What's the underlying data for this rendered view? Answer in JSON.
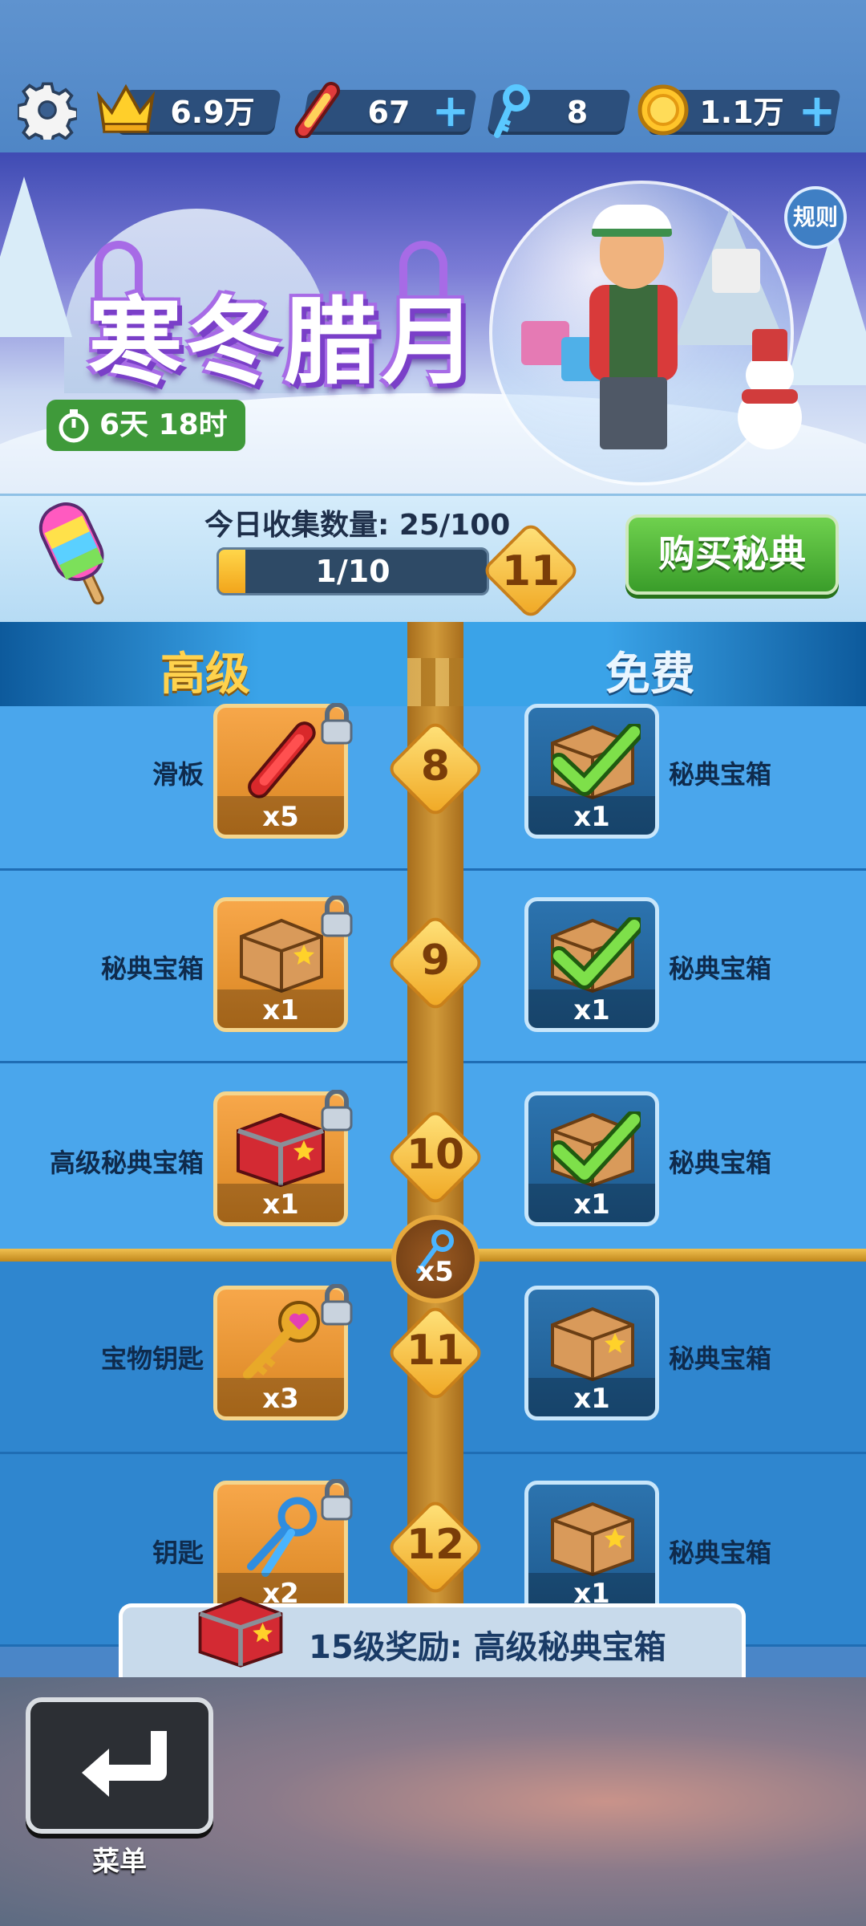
{
  "resources": {
    "crowns": "6.9万",
    "boards": "67",
    "keys": "8",
    "coins": "1.1万"
  },
  "event": {
    "title": "寒冬腊月",
    "timer": "6天 18时",
    "rules_label": "规则"
  },
  "collection": {
    "label": "今日收集数量: 25/100",
    "progress_text": "1/10",
    "progress_fraction": 0.1,
    "next_level": "11",
    "buy_label": "购买秘典"
  },
  "columns": {
    "premium": "高级",
    "free": "免费"
  },
  "rows": [
    {
      "level": "8",
      "premium_label": "滑板",
      "premium_qty": "x5",
      "premium_icon": "hoverboard-icon",
      "free_label": "秘典宝箱",
      "free_qty": "x1",
      "free_claimed": true
    },
    {
      "level": "9",
      "premium_label": "秘典宝箱",
      "premium_qty": "x1",
      "premium_icon": "crate-icon",
      "free_label": "秘典宝箱",
      "free_qty": "x1",
      "free_claimed": true
    },
    {
      "level": "10",
      "premium_label": "高级秘典宝箱",
      "premium_qty": "x1",
      "premium_icon": "red-chest-icon",
      "free_label": "秘典宝箱",
      "free_qty": "x1",
      "free_claimed": true
    },
    {
      "level": "11",
      "premium_label": "宝物钥匙",
      "premium_qty": "x3",
      "premium_icon": "golden-key-icon",
      "free_label": "秘典宝箱",
      "free_qty": "x1",
      "free_claimed": false
    },
    {
      "level": "12",
      "premium_label": "钥匙",
      "premium_qty": "x2",
      "premium_icon": "keys-icon",
      "free_label": "秘典宝箱",
      "free_qty": "x1",
      "free_claimed": false
    }
  ],
  "milestone": {
    "qty": "x5"
  },
  "final_reward": "15级奖励: 高级秘典宝箱",
  "footer": {
    "menu_label": "菜单"
  },
  "colors": {
    "accent_green": "#3a9d2a",
    "premium_gold": "#ffd24d",
    "progress_fill": "#f2a51b"
  }
}
